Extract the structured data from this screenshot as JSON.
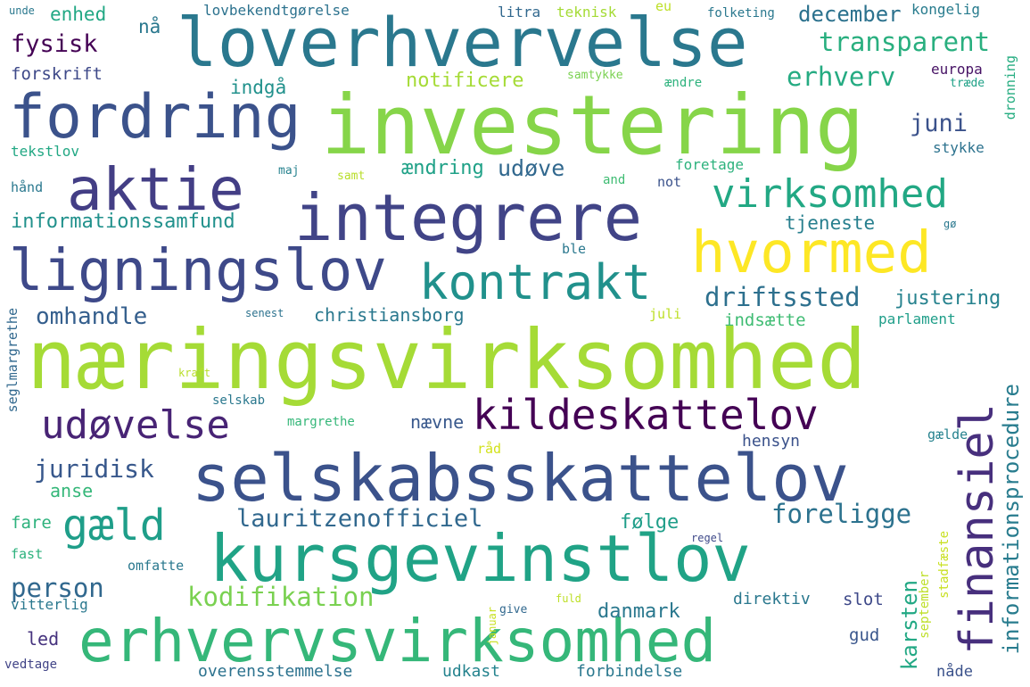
{
  "words": {
    "naeringsvirksomhed": {
      "text": "næringsvirksomhed",
      "color": "#a5db36"
    },
    "investering": {
      "text": "investering",
      "color": "#86d549"
    },
    "loverhvervelse": {
      "text": "loverhvervelse",
      "color": "#2a788e"
    },
    "fordring": {
      "text": "fordring",
      "color": "#3b528b"
    },
    "integrere": {
      "text": "integrere",
      "color": "#414487"
    },
    "aktie": {
      "text": "aktie",
      "color": "#433e85"
    },
    "ligningslov": {
      "text": "ligningslov",
      "color": "#3e4989"
    },
    "selskabsskattelov": {
      "text": "selskabsskattelov",
      "color": "#3b528b"
    },
    "kursgevinstlov": {
      "text": "kursgevinstlov",
      "color": "#20a386"
    },
    "erhvervsvirksomhed": {
      "text": "erhvervsvirksomhed",
      "color": "#35b779"
    },
    "hvormed": {
      "text": "hvormed",
      "color": "#fde725"
    },
    "kontrakt": {
      "text": "kontrakt",
      "color": "#21918c"
    },
    "virksomhed": {
      "text": "virksomhed",
      "color": "#22a884"
    },
    "kildeskattelov": {
      "text": "kildeskattelov",
      "color": "#440154"
    },
    "udoevelse": {
      "text": "udøvelse",
      "color": "#482475"
    },
    "finansiel": {
      "text": "finansiel",
      "color": "#472f7d"
    },
    "gaeld": {
      "text": "gæld",
      "color": "#1f9e89"
    },
    "driftssted": {
      "text": "driftssted",
      "color": "#2d708e"
    },
    "lauritzenofficiel": {
      "text": "lauritzenofficiel",
      "color": "#31688e"
    },
    "foreligge": {
      "text": "foreligge",
      "color": "#2c728e"
    },
    "juridisk": {
      "text": "juridisk",
      "color": "#38588c"
    },
    "kodifikation": {
      "text": "kodifikation",
      "color": "#7ad151"
    },
    "person": {
      "text": "person",
      "color": "#31688e"
    },
    "transparent": {
      "text": "transparent",
      "color": "#29af7f"
    },
    "erhverv": {
      "text": "erhverv",
      "color": "#25ab82"
    },
    "fysisk": {
      "text": "fysisk",
      "color": "#440154"
    },
    "forskrift": {
      "text": "forskrift",
      "color": "#3e4989"
    },
    "informationsprocedure": {
      "text": "informationsprocedure",
      "color": "#287c8e"
    },
    "omhandle": {
      "text": "omhandle",
      "color": "#355f8d"
    },
    "christiansborg": {
      "text": "christiansborg",
      "color": "#2a788e"
    },
    "justering": {
      "text": "justering",
      "color": "#26828e"
    },
    "informationssamfund": {
      "text": "informationssamfund",
      "color": "#21918c"
    },
    "udoeve": {
      "text": "udøve",
      "color": "#31688e"
    },
    "aendring": {
      "text": "ændring",
      "color": "#1fa187"
    },
    "juni": {
      "text": "juni",
      "color": "#3b528b"
    },
    "december": {
      "text": "december",
      "color": "#2c728e"
    },
    "enhed": {
      "text": "enhed",
      "color": "#22a884"
    },
    "notificere": {
      "text": "notificere",
      "color": "#a5db36"
    },
    "indgaa": {
      "text": "indgå",
      "color": "#21918c"
    },
    "naa": {
      "text": "nå",
      "color": "#2a788e"
    },
    "tjeneste": {
      "text": "tjeneste",
      "color": "#277f8e"
    },
    "karsten": {
      "text": "karsten",
      "color": "#22a884"
    },
    "danmark": {
      "text": "danmark",
      "color": "#2a788e"
    },
    "foelge": {
      "text": "følge",
      "color": "#1f9e89"
    },
    "naevne": {
      "text": "nævne",
      "color": "#38588c"
    },
    "anse": {
      "text": "anse",
      "color": "#35b779"
    },
    "fare": {
      "text": "fare",
      "color": "#2db27d"
    },
    "led": {
      "text": "led",
      "color": "#46337e"
    },
    "indsaette": {
      "text": "indsætte",
      "color": "#3fbc73"
    },
    "hensyn": {
      "text": "hensyn",
      "color": "#3b528b"
    },
    "direktiv": {
      "text": "direktiv",
      "color": "#2a788e"
    },
    "slot": {
      "text": "slot",
      "color": "#3e4989"
    },
    "gud": {
      "text": "gud",
      "color": "#39568c"
    },
    "overensstemmelse": {
      "text": "overensstemmelse",
      "color": "#2c728e"
    },
    "udkast": {
      "text": "udkast",
      "color": "#25838e"
    },
    "forbindelse": {
      "text": "forbindelse",
      "color": "#2a788e"
    },
    "naade": {
      "text": "nåde",
      "color": "#3b528b"
    },
    "lovbekendtgoerelse": {
      "text": "lovbekendtgørelse",
      "color": "#2c728e"
    },
    "litra": {
      "text": "litra",
      "color": "#31688e"
    },
    "teknisk": {
      "text": "teknisk",
      "color": "#a5db36"
    },
    "eu": {
      "text": "eu",
      "color": "#bddf26"
    },
    "folketing": {
      "text": "folketing",
      "color": "#2a788e"
    },
    "kongelig": {
      "text": "kongelig",
      "color": "#287c8e"
    },
    "unde": {
      "text": "unde",
      "color": "#2a788e"
    },
    "europa": {
      "text": "europa",
      "color": "#471365"
    },
    "traede": {
      "text": "træde",
      "color": "#1fa187"
    },
    "dronning": {
      "text": "dronning",
      "color": "#26ad81"
    },
    "samtykke": {
      "text": "samtykke",
      "color": "#7ad151"
    },
    "aendre": {
      "text": "ændre",
      "color": "#2db27d"
    },
    "stykke": {
      "text": "stykke",
      "color": "#2c728e"
    },
    "tekstlov": {
      "text": "tekstlov",
      "color": "#22a884"
    },
    "foretage": {
      "text": "foretage",
      "color": "#2db27d"
    },
    "maj": {
      "text": "maj",
      "color": "#26828e"
    },
    "samt": {
      "text": "samt",
      "color": "#b8de29"
    },
    "haand": {
      "text": "hånd",
      "color": "#2a788e"
    },
    "and": {
      "text": "and",
      "color": "#3fbc73"
    },
    "not": {
      "text": "not",
      "color": "#3b528b"
    },
    "goe": {
      "text": "gø",
      "color": "#2a788e"
    },
    "ble": {
      "text": "ble",
      "color": "#2a788e"
    },
    "parlament": {
      "text": "parlament",
      "color": "#1f9e89"
    },
    "juli": {
      "text": "juli",
      "color": "#bddf26"
    },
    "senest": {
      "text": "senest",
      "color": "#2c728e"
    },
    "seglmargrethe": {
      "text": "seglmargrethe",
      "color": "#31688e"
    },
    "kraft": {
      "text": "kraft",
      "color": "#b8de29"
    },
    "selskab": {
      "text": "selskab",
      "color": "#2a788e"
    },
    "margrethe": {
      "text": "margrethe",
      "color": "#35b779"
    },
    "raad": {
      "text": "råd",
      "color": "#d2e21b"
    },
    "gaelde": {
      "text": "gælde",
      "color": "#26828e"
    },
    "stadfaeste": {
      "text": "stadfæste",
      "color": "#c8e020"
    },
    "september": {
      "text": "september",
      "color": "#bddf26"
    },
    "regel": {
      "text": "regel",
      "color": "#3e4989"
    },
    "omfatte": {
      "text": "omfatte",
      "color": "#2a788e"
    },
    "fast": {
      "text": "fast",
      "color": "#2db27d"
    },
    "vitterlig": {
      "text": "vitterlig",
      "color": "#2a788e"
    },
    "give": {
      "text": "give",
      "color": "#31688e"
    },
    "fuld": {
      "text": "fuld",
      "color": "#bddf26"
    },
    "januar": {
      "text": "januar",
      "color": "#c8e020"
    },
    "vedtage": {
      "text": "vedtage",
      "color": "#414487"
    }
  }
}
